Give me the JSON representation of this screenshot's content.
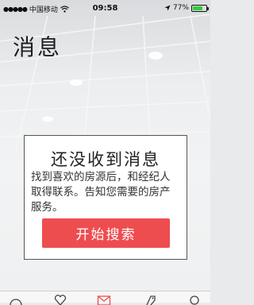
{
  "status_bar": {
    "signal": "●●●●●",
    "carrier": "中国移动",
    "time": "09:58",
    "battery_text": "77%",
    "battery_level": 0.77
  },
  "page": {
    "title": "消息"
  },
  "empty_state": {
    "title": "还没收到消息",
    "lines": [
      "找到喜欢的房源后，和经纪人",
      "取得联系。告知您需要的房产",
      "服务。"
    ],
    "button_label": "开始搜索"
  },
  "tab_bar": {
    "icons": [
      "home-icon",
      "heart-icon",
      "message-icon",
      "tag-icon",
      "profile-icon"
    ],
    "active_color": "#ee4d4f",
    "inactive_color": "#444444"
  },
  "colors": {
    "accent": "#ee4d4f",
    "battery": "#2ecc40"
  }
}
